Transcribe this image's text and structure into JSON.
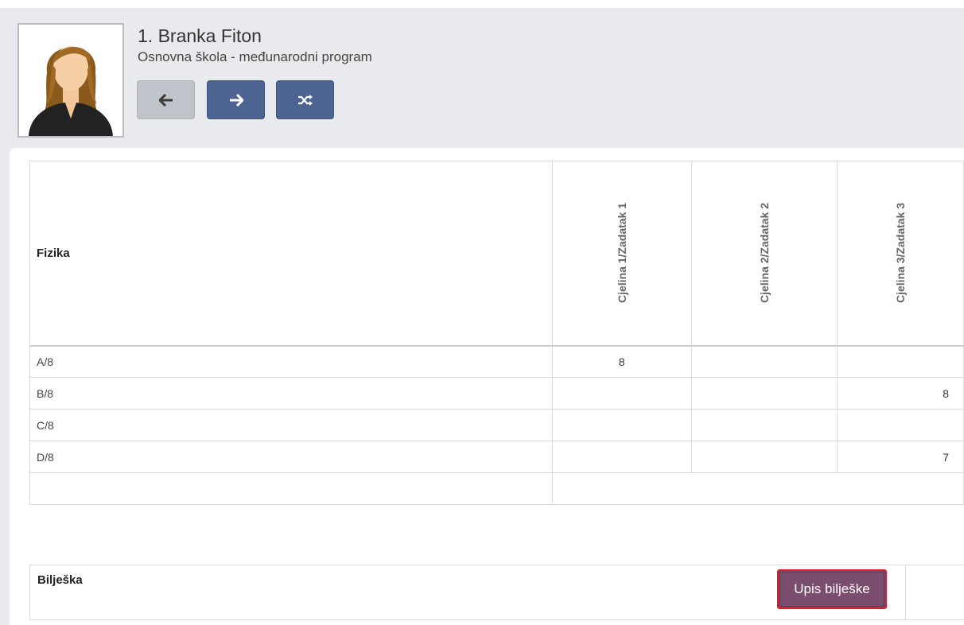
{
  "student": {
    "name": "1. Branka Fiton",
    "program": "Osnovna škola - međunarodni program"
  },
  "nav": {
    "prev_icon": "arrow-left-icon",
    "next_icon": "arrow-right-icon",
    "shuffle_icon": "shuffle-icon"
  },
  "table": {
    "subject": "Fizika",
    "columns": [
      "Cjelina 1/Zadatak 1",
      "Cjelina 2/Zadatak 2",
      "Cjelina 3/Zadatak 3"
    ],
    "rows": [
      {
        "label": "A/8",
        "values": [
          "8",
          "",
          ""
        ]
      },
      {
        "label": "B/8",
        "values": [
          "",
          "",
          "8"
        ]
      },
      {
        "label": "C/8",
        "values": [
          "",
          "",
          ""
        ]
      },
      {
        "label": "D/8",
        "values": [
          "",
          "",
          "7"
        ]
      }
    ]
  },
  "note": {
    "label": "Bilješka",
    "button_label": "Upis bilješke"
  },
  "colors": {
    "nav_active": "#4d6493",
    "nav_disabled": "#bfc3ca",
    "note_button": "#7a4d6e",
    "highlight_border": "#e0192b"
  }
}
